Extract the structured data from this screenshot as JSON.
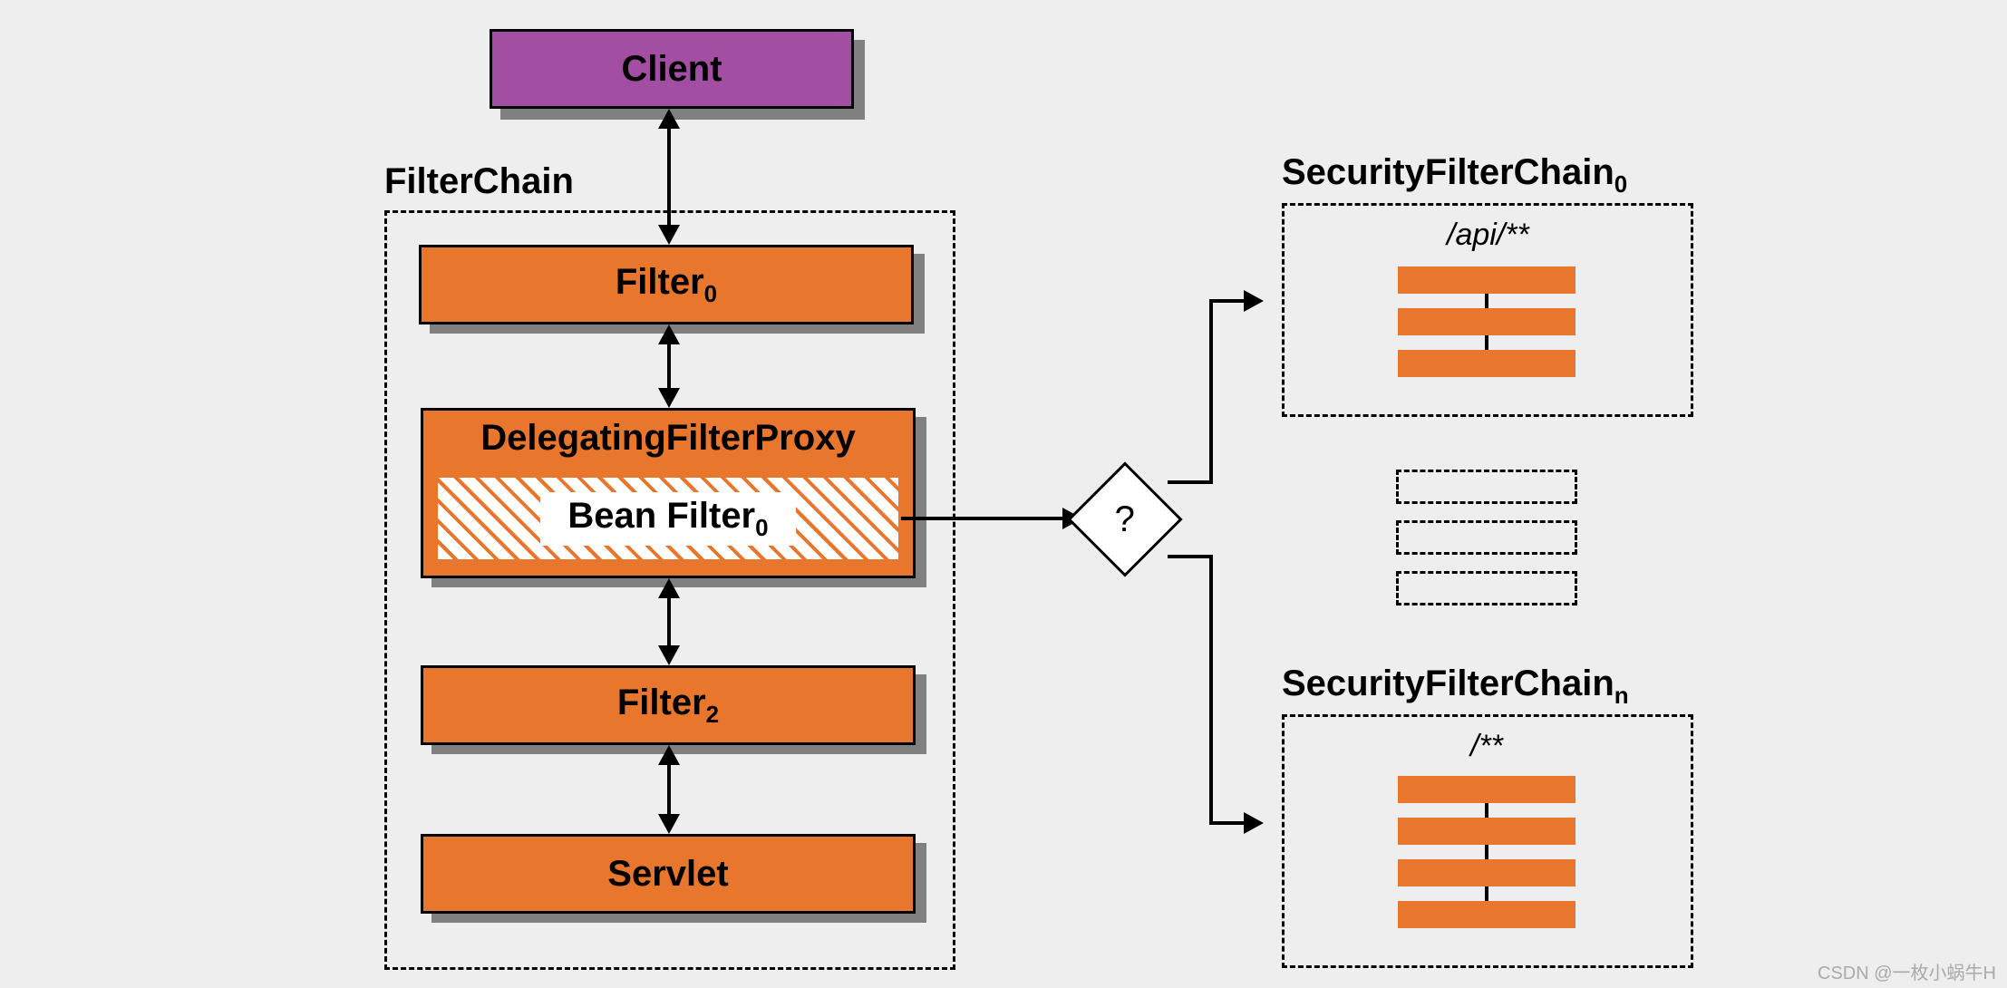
{
  "boxes": {
    "client": "Client",
    "filter0": "Filter",
    "filter0_sub": "0",
    "filter2": "Filter",
    "filter2_sub": "2",
    "servlet": "Servlet",
    "delegating": "DelegatingFilterProxy",
    "bean": "Bean Filter",
    "bean_sub": "0"
  },
  "containers": {
    "filterchain": "FilterChain",
    "sfc0": "SecurityFilterChain",
    "sfc0_sub": "0",
    "sfcn": "SecurityFilterChain",
    "sfcn_sub": "n"
  },
  "patterns": {
    "sfc0": "/api/**",
    "sfcn": "/**"
  },
  "decision": "?",
  "watermark": "CSDN @一枚小蜗牛H",
  "colors": {
    "orange": "#e8762d",
    "purple": "#a24ea2",
    "bg": "#eeeeee"
  }
}
